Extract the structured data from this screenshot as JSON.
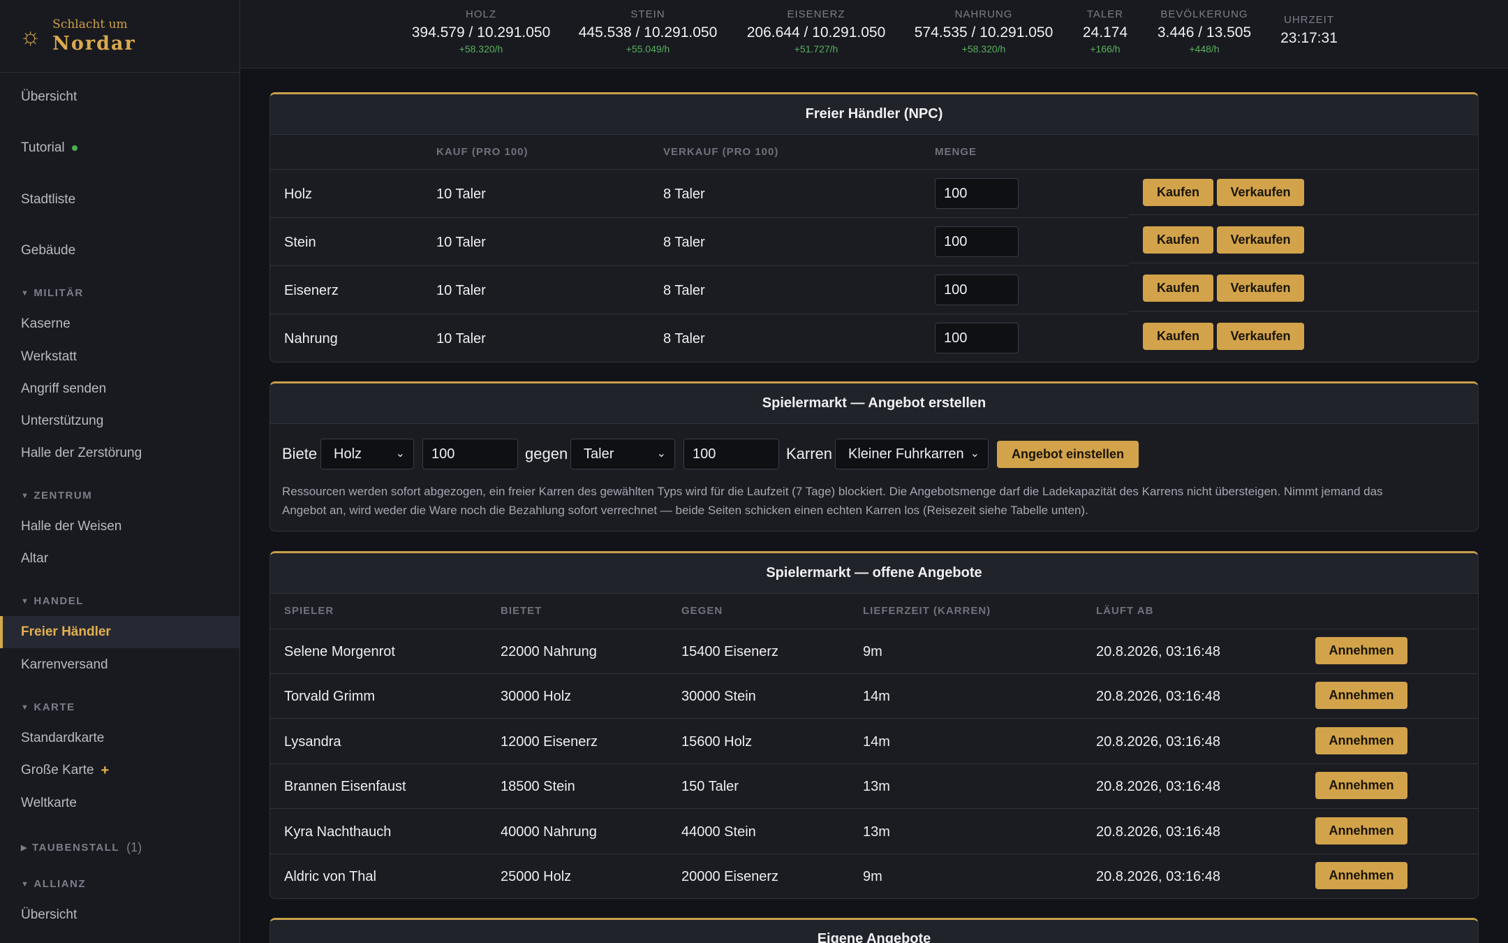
{
  "brand": {
    "line1": "Schlacht um",
    "line2": "Nordar",
    "icon": "sun-icon"
  },
  "sidebar": {
    "top_items": [
      {
        "label": "Übersicht"
      },
      {
        "label": "Tutorial"
      },
      {
        "label": "Stadtliste"
      },
      {
        "label": "Gebäude"
      }
    ],
    "sections": {
      "militaer": {
        "title": "MILITÄR",
        "items": [
          "Kaserne",
          "Werkstatt",
          "Angriff senden",
          "Unterstützung",
          "Halle der Zerstörung"
        ]
      },
      "zentrum": {
        "title": "ZENTRUM",
        "items": [
          "Halle der Weisen",
          "Altar"
        ]
      },
      "handel": {
        "title": "HANDEL",
        "items": [
          "Freier Händler",
          "Karrenversand"
        ]
      },
      "karte": {
        "title": "KARTE",
        "items": [
          "Standardkarte",
          "Große Karte",
          "Weltkarte"
        ]
      },
      "taubenstall": {
        "title": "TAUBENSTALL",
        "count": "(1)"
      },
      "allianz": {
        "title": "ALLIANZ",
        "items": [
          "Übersicht"
        ]
      }
    }
  },
  "topbar": {
    "resources": [
      {
        "label": "HOLZ",
        "value": "394.579 / 10.291.050",
        "rate": "+58.320/h"
      },
      {
        "label": "STEIN",
        "value": "445.538 / 10.291.050",
        "rate": "+55.049/h"
      },
      {
        "label": "EISENERZ",
        "value": "206.644 / 10.291.050",
        "rate": "+51.727/h"
      },
      {
        "label": "NAHRUNG",
        "value": "574.535 / 10.291.050",
        "rate": "+58.320/h"
      },
      {
        "label": "TALER",
        "value": "24.174",
        "rate": "+166/h"
      },
      {
        "label": "BEVÖLKERUNG",
        "value": "3.446 / 13.505",
        "rate": "+448/h"
      }
    ],
    "clock": {
      "label": "UHRZEIT",
      "value": "23:17:31"
    }
  },
  "npc": {
    "title": "Freier Händler (NPC)",
    "headers": {
      "buy": "KAUF (PRO 100)",
      "sell": "VERKAUF (PRO 100)",
      "qty": "MENGE"
    },
    "rows": [
      {
        "resource": "Holz",
        "buy": "10 Taler",
        "sell": "8 Taler",
        "qty": "100"
      },
      {
        "resource": "Stein",
        "buy": "10 Taler",
        "sell": "8 Taler",
        "qty": "100"
      },
      {
        "resource": "Eisenerz",
        "buy": "10 Taler",
        "sell": "8 Taler",
        "qty": "100"
      },
      {
        "resource": "Nahrung",
        "buy": "10 Taler",
        "sell": "8 Taler",
        "qty": "100"
      }
    ],
    "buy_label": "Kaufen",
    "sell_label": "Verkaufen"
  },
  "create_offer": {
    "title": "Spielermarkt — Angebot erstellen",
    "offer_label": "Biete",
    "offer_resource": "Holz",
    "offer_amount": "100",
    "for_label": "gegen",
    "for_resource": "Taler",
    "for_amount": "100",
    "cart_label": "Karren",
    "cart_type": "Kleiner Fuhrkarren",
    "submit_label": "Angebot einstellen",
    "note_line1": "Ressourcen werden sofort abgezogen, ein freier Karren des gewählten Typs wird für die Laufzeit (7 Tage) blockiert. Die Angebotsmenge darf die Ladekapazität des Karrens nicht übersteigen. Nimmt jemand das",
    "note_line2": "Angebot an, wird weder die Ware noch die Bezahlung sofort verrechnet — beide Seiten schicken einen echten Karren los (Reisezeit siehe Tabelle unten)."
  },
  "open_offers": {
    "title": "Spielermarkt — offene Angebote",
    "headers": {
      "player": "SPIELER",
      "offers": "BIETET",
      "for": "GEGEN",
      "delivery": "LIEFERZEIT (KARREN)",
      "expires": "LÄUFT AB"
    },
    "rows": [
      {
        "player": "Selene Morgenrot",
        "offers": "22000 Nahrung",
        "for": "15400 Eisenerz",
        "delivery": "9m",
        "expires": "20.8.2026, 03:16:48"
      },
      {
        "player": "Torvald Grimm",
        "offers": "30000 Holz",
        "for": "30000 Stein",
        "delivery": "14m",
        "expires": "20.8.2026, 03:16:48"
      },
      {
        "player": "Lysandra",
        "offers": "12000 Eisenerz",
        "for": "15600 Holz",
        "delivery": "14m",
        "expires": "20.8.2026, 03:16:48"
      },
      {
        "player": "Brannen Eisenfaust",
        "offers": "18500 Stein",
        "for": "150 Taler",
        "delivery": "13m",
        "expires": "20.8.2026, 03:16:48"
      },
      {
        "player": "Kyra Nachthauch",
        "offers": "40000 Nahrung",
        "for": "44000 Stein",
        "delivery": "13m",
        "expires": "20.8.2026, 03:16:48"
      },
      {
        "player": "Aldric von Thal",
        "offers": "25000 Holz",
        "for": "20000 Eisenerz",
        "delivery": "9m",
        "expires": "20.8.2026, 03:16:48"
      }
    ],
    "accept_label": "Annehmen"
  },
  "own_offers": {
    "title": "Eigene Angebote"
  },
  "colors": {
    "accent": "#d2a34a",
    "active_nav": "#e3b04f",
    "rate_green": "#58b15c",
    "background": "#121318"
  }
}
